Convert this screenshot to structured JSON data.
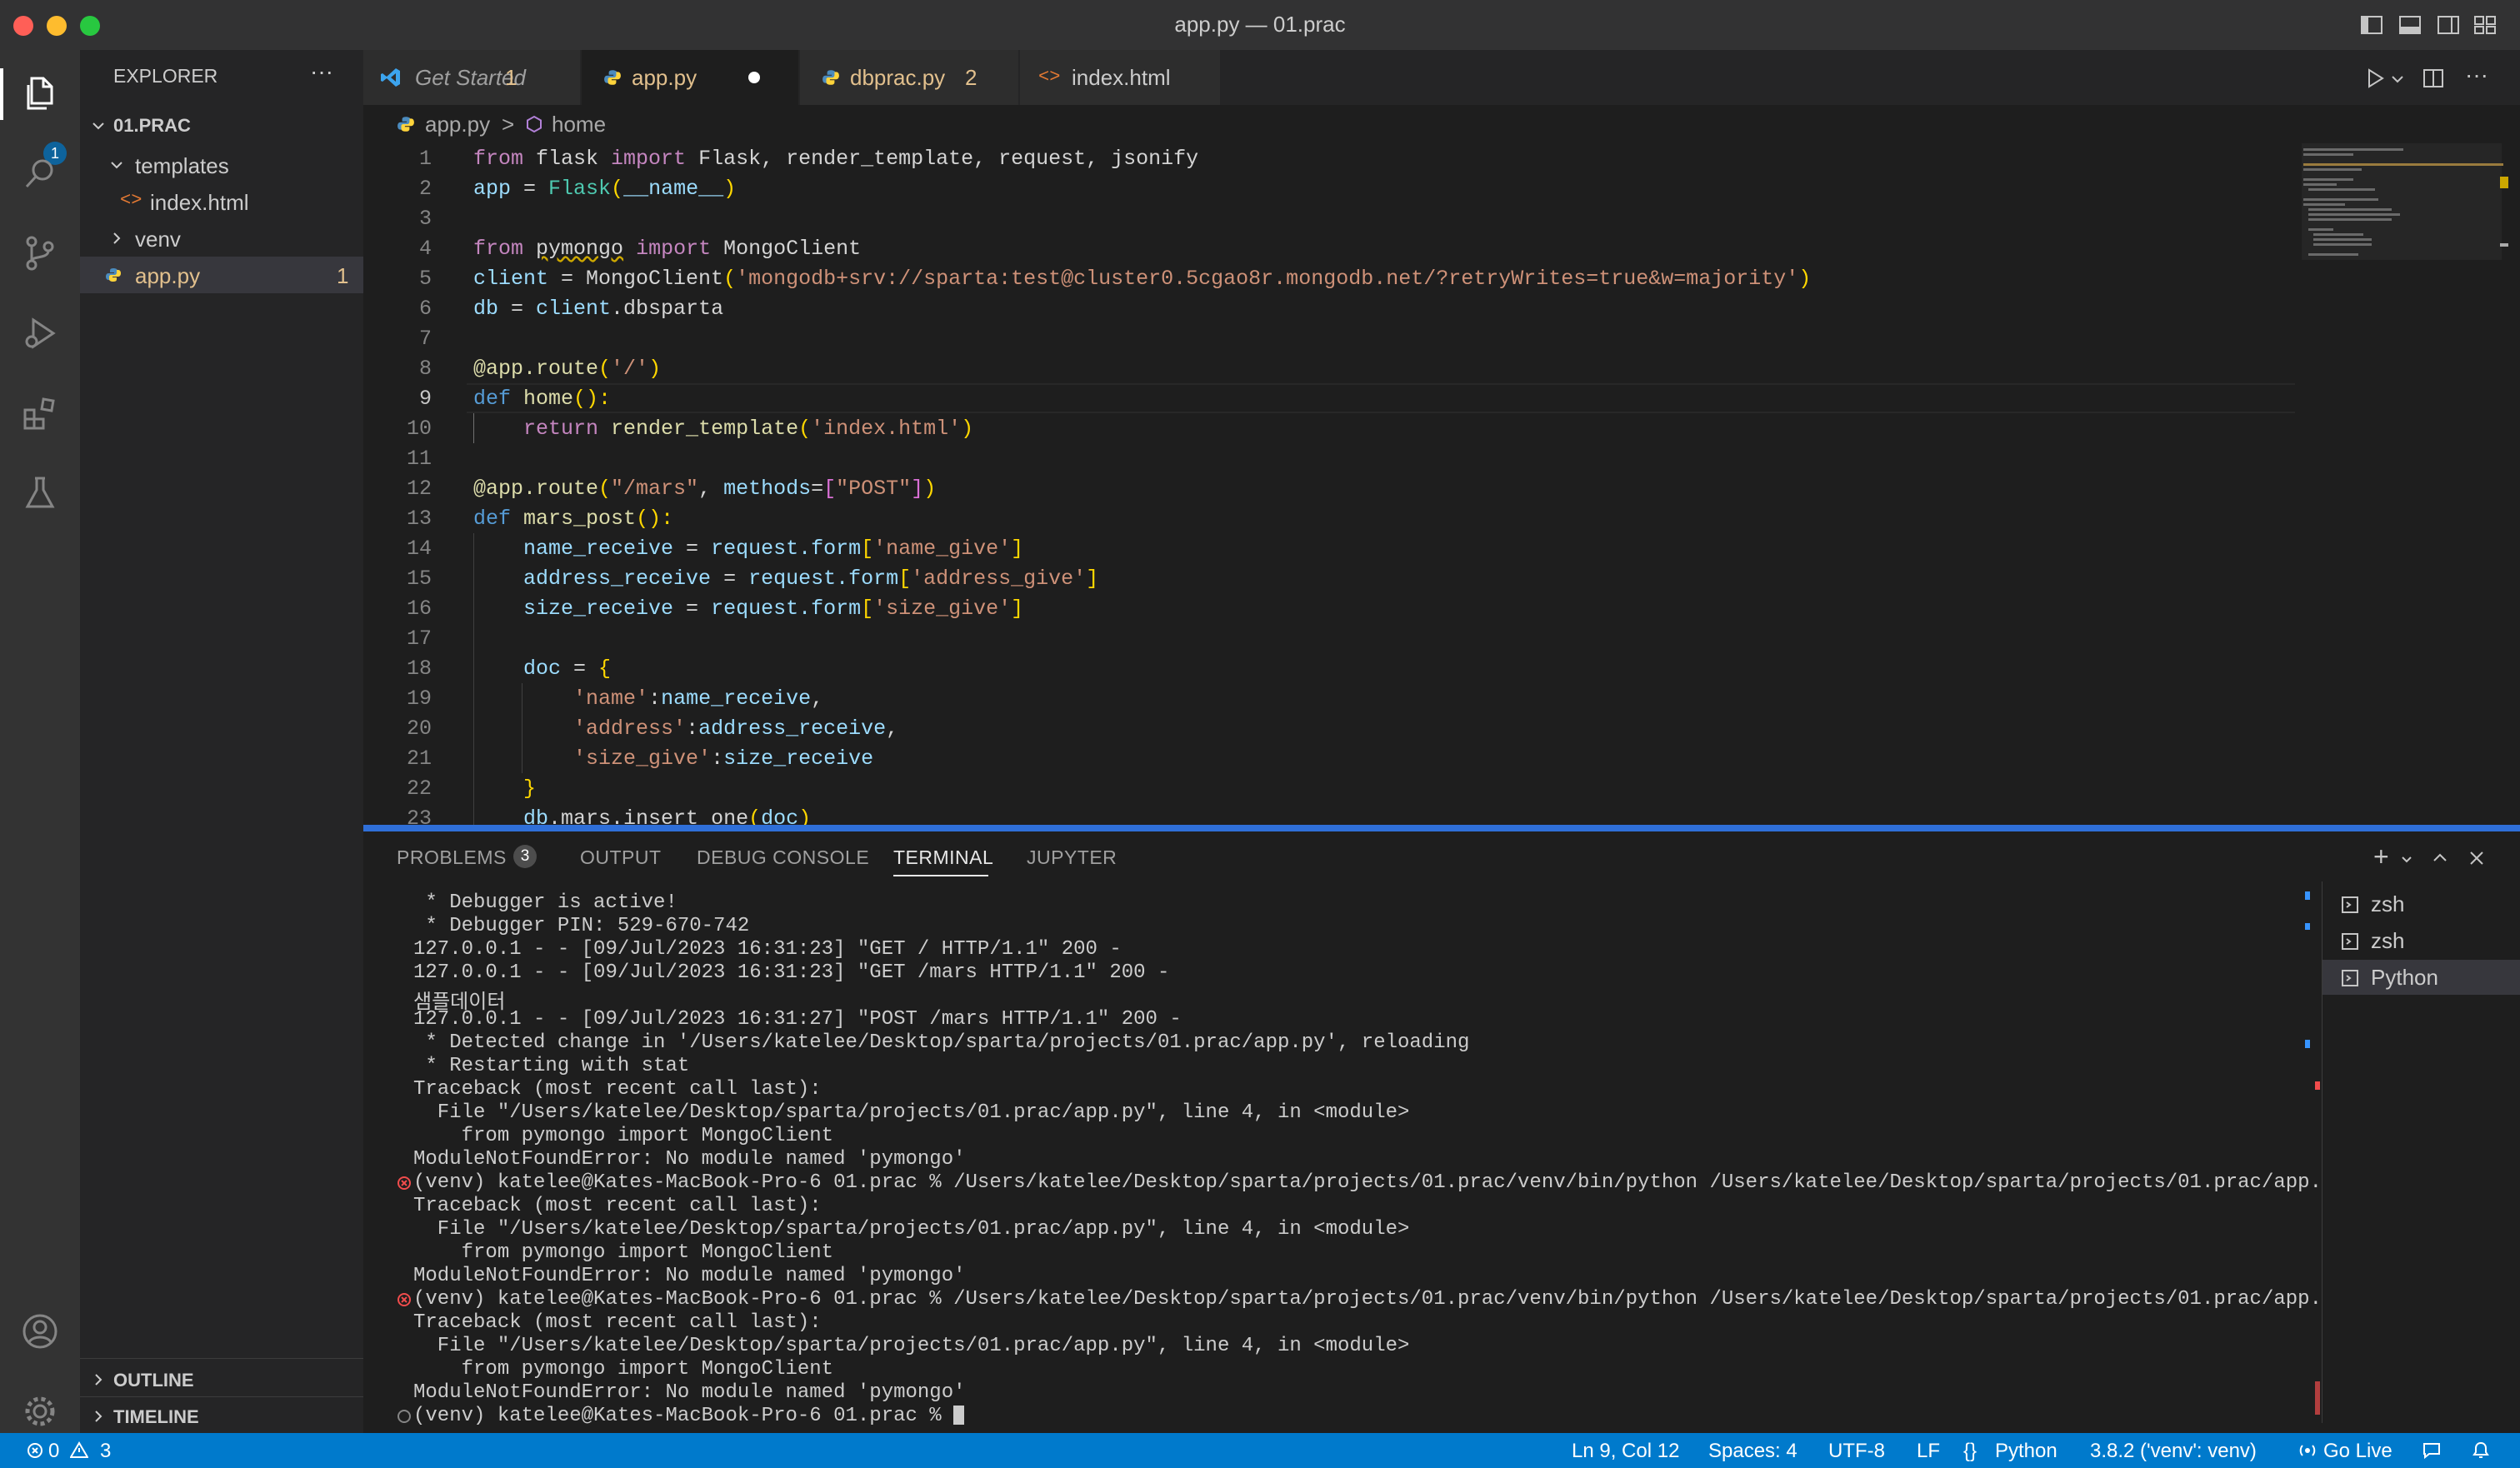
{
  "window": {
    "title": "app.py — 01.prac"
  },
  "activity_bar": {
    "explorer_badge": "1",
    "icons": [
      "explorer-icon",
      "search-icon",
      "source-control-icon",
      "run-debug-icon",
      "extensions-icon",
      "testing-icon",
      "account-icon",
      "settings-gear-icon"
    ]
  },
  "sidebar": {
    "header": "EXPLORER",
    "more": "···",
    "folder": "01.PRAC",
    "items": [
      {
        "label": "templates",
        "kind": "folder-open"
      },
      {
        "label": "index.html",
        "kind": "html-file"
      },
      {
        "label": "venv",
        "kind": "folder-closed"
      },
      {
        "label": "app.py",
        "kind": "python-file",
        "badge": "1"
      }
    ],
    "outline": "OUTLINE",
    "timeline": "TIMELINE"
  },
  "tabs": [
    {
      "label": "Get Started",
      "badge": ""
    },
    {
      "label": "app.py",
      "badge": "1"
    },
    {
      "label": "dbprac.py",
      "badge": "2"
    },
    {
      "label": "index.html",
      "badge": ""
    }
  ],
  "breadcrumb": {
    "file": "app.py",
    "symbol": "home",
    "separator": ">"
  },
  "code_lines": [
    "1",
    "2",
    "3",
    "4",
    "5",
    "6",
    "7",
    "8",
    "9",
    "10",
    "11",
    "12",
    "13",
    "14",
    "15",
    "16",
    "17",
    "18",
    "19",
    "20",
    "21",
    "22",
    "23"
  ],
  "code": {
    "l1": [
      "from",
      " flask ",
      "import",
      " Flask, render_template, request, jsonify"
    ],
    "l2": [
      "app",
      " = ",
      "Flask",
      "(",
      "__name__",
      ")"
    ],
    "l4": [
      "from",
      " ",
      "pymongo",
      " ",
      "import",
      " MongoClient"
    ],
    "l5": [
      "client",
      " = ",
      "MongoClient",
      "(",
      "'mongodb+srv://sparta:test@cluster0.5cgao8r.mongodb.net/?retryWrites=true&w=majority'",
      ")"
    ],
    "l6": [
      "db",
      " = ",
      "client",
      ".dbsparta"
    ],
    "l8": [
      "@app.route",
      "(",
      "'/'",
      ")"
    ],
    "l9": [
      "def",
      " ",
      "home",
      "():"
    ],
    "l10": [
      "return",
      " ",
      "render_template",
      "(",
      "'index.html'",
      ")"
    ],
    "l12": [
      "@app.route",
      "(",
      "\"/mars\"",
      ", ",
      "methods",
      "=",
      "[",
      "\"POST\"",
      "]",
      ")"
    ],
    "l13": [
      "def",
      " ",
      "mars_post",
      "():"
    ],
    "l14": [
      "name_receive",
      " = ",
      "request",
      ".form",
      "[",
      "'name_give'",
      "]"
    ],
    "l15": [
      "address_receive",
      " = ",
      "request",
      ".form",
      "[",
      "'address_give'",
      "]"
    ],
    "l16": [
      "size_receive",
      " = ",
      "request",
      ".form",
      "[",
      "'size_give'",
      "]"
    ],
    "l18": [
      "doc",
      " = ",
      "{"
    ],
    "l19": [
      "'name'",
      ":",
      "name_receive",
      ","
    ],
    "l20": [
      "'address'",
      ":",
      "address_receive",
      ","
    ],
    "l21": [
      "'size_give'",
      ":",
      "size_receive"
    ],
    "l22": [
      "}"
    ],
    "l23": [
      "db",
      ".mars.insert_one",
      "(",
      "doc",
      ")"
    ]
  },
  "panel": {
    "tabs": [
      "PROBLEMS",
      "OUTPUT",
      "DEBUG CONSOLE",
      "TERMINAL",
      "JUPYTER"
    ],
    "problems_count": "3",
    "active_tab": "TERMINAL",
    "terminal_lines": [
      " * Debugger is active!",
      " * Debugger PIN: 529-670-742",
      "127.0.0.1 - - [09/Jul/2023 16:31:23] \"GET / HTTP/1.1\" 200 -",
      "127.0.0.1 - - [09/Jul/2023 16:31:23] \"GET /mars HTTP/1.1\" 200 -",
      "샘플데이터",
      "127.0.0.1 - - [09/Jul/2023 16:31:27] \"POST /mars HTTP/1.1\" 200 -",
      " * Detected change in '/Users/katelee/Desktop/sparta/projects/01.prac/app.py', reloading",
      " * Restarting with stat",
      "Traceback (most recent call last):",
      "  File \"/Users/katelee/Desktop/sparta/projects/01.prac/app.py\", line 4, in <module>",
      "    from pymongo import MongoClient",
      "ModuleNotFoundError: No module named 'pymongo'",
      "(venv) katelee@Kates-MacBook-Pro-6 01.prac % /Users/katelee/Desktop/sparta/projects/01.prac/venv/bin/python /Users/katelee/Desktop/sparta/projects/01.prac/app.py",
      "Traceback (most recent call last):",
      "  File \"/Users/katelee/Desktop/sparta/projects/01.prac/app.py\", line 4, in <module>",
      "    from pymongo import MongoClient",
      "ModuleNotFoundError: No module named 'pymongo'",
      "(venv) katelee@Kates-MacBook-Pro-6 01.prac % /Users/katelee/Desktop/sparta/projects/01.prac/venv/bin/python /Users/katelee/Desktop/sparta/projects/01.prac/app.py",
      "Traceback (most recent call last):",
      "  File \"/Users/katelee/Desktop/sparta/projects/01.prac/app.py\", line 4, in <module>",
      "    from pymongo import MongoClient",
      "ModuleNotFoundError: No module named 'pymongo'",
      "(venv) katelee@Kates-MacBook-Pro-6 01.prac % "
    ],
    "terminals": [
      "zsh",
      "zsh",
      "Python"
    ]
  },
  "statusbar": {
    "errors": "0",
    "warnings": "3",
    "position": "Ln 9, Col 12",
    "spaces": "Spaces: 4",
    "encoding": "UTF-8",
    "eol": "LF",
    "language": "Python",
    "interpreter": "3.8.2 ('venv': venv)",
    "golive": "Go Live"
  },
  "colors": {
    "accent": "#007acc",
    "panel_sash": "#2f6fd8",
    "modified_tab": "#e2c08d",
    "python_blue": "#4b8bbe"
  }
}
